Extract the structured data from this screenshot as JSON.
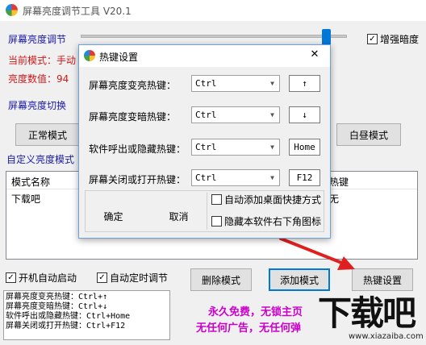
{
  "main": {
    "title": "屏幕亮度调节工具 V20.1",
    "section_brightness": "屏幕亮度调节",
    "current_mode_label": "当前模式：手动",
    "brightness_value_label": "亮度数值：94",
    "enhance_brightness_label": "增强暗度",
    "enhance_checked": "✓",
    "section_switch": "屏幕亮度切换",
    "normal_mode_button": "正常模式",
    "daylight_mode_button": "白昼模式",
    "section_custom": "自定义亮度模式",
    "table_headers": [
      "模式名称",
      "热键"
    ],
    "table_rows": [
      [
        "下载吧",
        "无"
      ]
    ],
    "autostart_label": "开机自动启动",
    "autostart_checked": "✓",
    "timed_adjust_label": "自动定时调节",
    "timed_checked": "✓",
    "delete_mode_button": "删除模式",
    "add_mode_button": "添加模式",
    "hotkey_settings_button": "热键设置",
    "hotkey_info_lines": [
      "屏幕亮度变亮热键：Ctrl+↑",
      "屏幕亮度变暗热键：Ctrl+↓",
      "软件呼出或隐藏热键：Ctrl+Home",
      "屏幕关闭或打开热键：Ctrl+F12"
    ],
    "promo_line1": "永久免费，无锁主页",
    "promo_line2": "无任何广告，无任何弹",
    "watermark_text": "下载吧",
    "watermark_url": "www.xiazaiba.com"
  },
  "dialog": {
    "title": "热键设置",
    "close_symbol": "✕",
    "rows": [
      {
        "label": "屏幕亮度变亮热键：",
        "modifier": "Ctrl",
        "key": "↑"
      },
      {
        "label": "屏幕亮度变暗热键：",
        "modifier": "Ctrl",
        "key": "↓"
      },
      {
        "label": "软件呼出或隐藏热键：",
        "modifier": "Ctrl",
        "key": "Home"
      },
      {
        "label": "屏幕关闭或打开热键：",
        "modifier": "Ctrl",
        "key": "F12"
      }
    ],
    "add_shortcut_label": "自动添加桌面快捷方式",
    "hide_tray_label": "隐藏本软件右下角图标",
    "ok_button": "确定",
    "cancel_button": "取消"
  },
  "colors": {
    "accent_blue": "#1a1aa6",
    "mode_red": "#d01818",
    "promo_magenta": "#cc00cc",
    "annotation_arrow": "#e02020"
  }
}
